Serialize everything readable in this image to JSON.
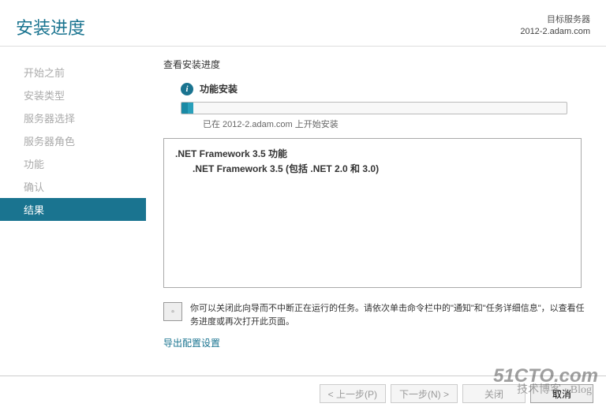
{
  "header": {
    "title": "安装进度",
    "server_label": "目标服务器",
    "server_name": "2012-2.adam.com"
  },
  "sidebar": {
    "items": [
      {
        "label": "开始之前"
      },
      {
        "label": "安装类型"
      },
      {
        "label": "服务器选择"
      },
      {
        "label": "服务器角色"
      },
      {
        "label": "功能"
      },
      {
        "label": "确认"
      },
      {
        "label": "结果"
      }
    ]
  },
  "content": {
    "section_label": "查看安装进度",
    "info_text": "功能安装",
    "progress_label": "已在 2012-2.adam.com 上开始安装",
    "feature_line1": ".NET Framework 3.5 功能",
    "feature_line2": ".NET Framework 3.5 (包括 .NET 2.0 和 3.0)",
    "note_text": "你可以关闭此向导而不中断正在运行的任务。请依次单击命令栏中的\"通知\"和\"任务详细信息\"，以查看任务进度或再次打开此页面。",
    "export_link": "导出配置设置"
  },
  "footer": {
    "prev": "< 上一步(P)",
    "next": "下一步(N) >",
    "close": "关闭",
    "cancel": "取消"
  },
  "watermark": {
    "main": "51CTO.com",
    "sub": "技术博客 · Blog"
  }
}
